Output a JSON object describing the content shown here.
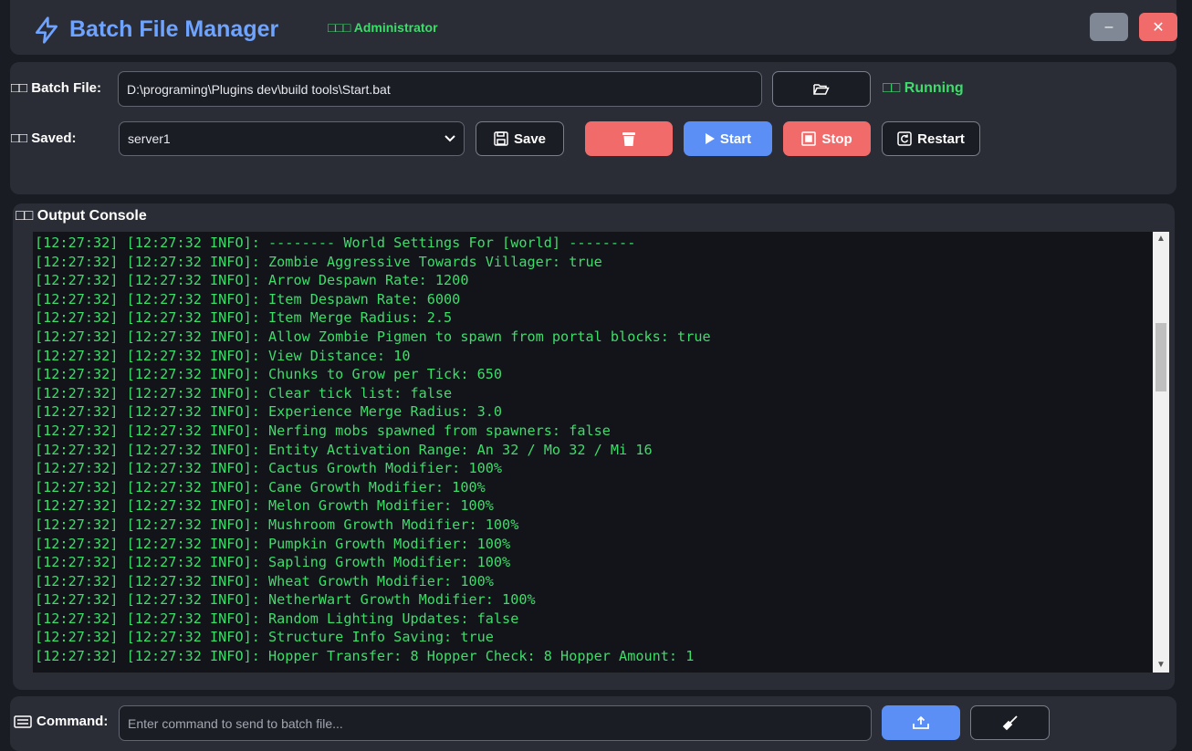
{
  "header": {
    "title": "Batch File Manager",
    "admin_label": "□□□ Administrator",
    "minimize_label": "–",
    "close_label": "✕"
  },
  "controls": {
    "batch_file_label": "□□ Batch File:",
    "batch_file_path": "D:\\programing\\Plugins dev\\build tools\\Start.bat",
    "status": "□□ Running",
    "saved_label": "□□ Saved:",
    "saved_selected": "server1",
    "save_label": "Save",
    "start_label": "Start",
    "stop_label": "Stop",
    "restart_label": "Restart"
  },
  "console": {
    "title": "□□ Output Console",
    "lines": [
      "[12:27:32] [12:27:32 INFO]: -------- World Settings For [world] --------",
      "[12:27:32] [12:27:32 INFO]: Zombie Aggressive Towards Villager: true",
      "[12:27:32] [12:27:32 INFO]: Arrow Despawn Rate: 1200",
      "[12:27:32] [12:27:32 INFO]: Item Despawn Rate: 6000",
      "[12:27:32] [12:27:32 INFO]: Item Merge Radius: 2.5",
      "[12:27:32] [12:27:32 INFO]: Allow Zombie Pigmen to spawn from portal blocks: true",
      "[12:27:32] [12:27:32 INFO]: View Distance: 10",
      "[12:27:32] [12:27:32 INFO]: Chunks to Grow per Tick: 650",
      "[12:27:32] [12:27:32 INFO]: Clear tick list: false",
      "[12:27:32] [12:27:32 INFO]: Experience Merge Radius: 3.0",
      "[12:27:32] [12:27:32 INFO]: Nerfing mobs spawned from spawners: false",
      "[12:27:32] [12:27:32 INFO]: Entity Activation Range: An 32 / Mo 32 / Mi 16",
      "[12:27:32] [12:27:32 INFO]: Cactus Growth Modifier: 100%",
      "[12:27:32] [12:27:32 INFO]: Cane Growth Modifier: 100%",
      "[12:27:32] [12:27:32 INFO]: Melon Growth Modifier: 100%",
      "[12:27:32] [12:27:32 INFO]: Mushroom Growth Modifier: 100%",
      "[12:27:32] [12:27:32 INFO]: Pumpkin Growth Modifier: 100%",
      "[12:27:32] [12:27:32 INFO]: Sapling Growth Modifier: 100%",
      "[12:27:32] [12:27:32 INFO]: Wheat Growth Modifier: 100%",
      "[12:27:32] [12:27:32 INFO]: NetherWart Growth Modifier: 100%",
      "[12:27:32] [12:27:32 INFO]: Random Lighting Updates: false",
      "[12:27:32] [12:27:32 INFO]: Structure Info Saving: true",
      "[12:27:32] [12:27:32 INFO]: Hopper Transfer: 8 Hopper Check: 8 Hopper Amount: 1"
    ]
  },
  "command": {
    "label": "Command:",
    "placeholder": "Enter command to send to batch file..."
  },
  "colors": {
    "accent_blue": "#5b8ff5",
    "danger_red": "#f26b6b",
    "running_green": "#3ddc6b",
    "console_text": "#3fdc6a"
  }
}
